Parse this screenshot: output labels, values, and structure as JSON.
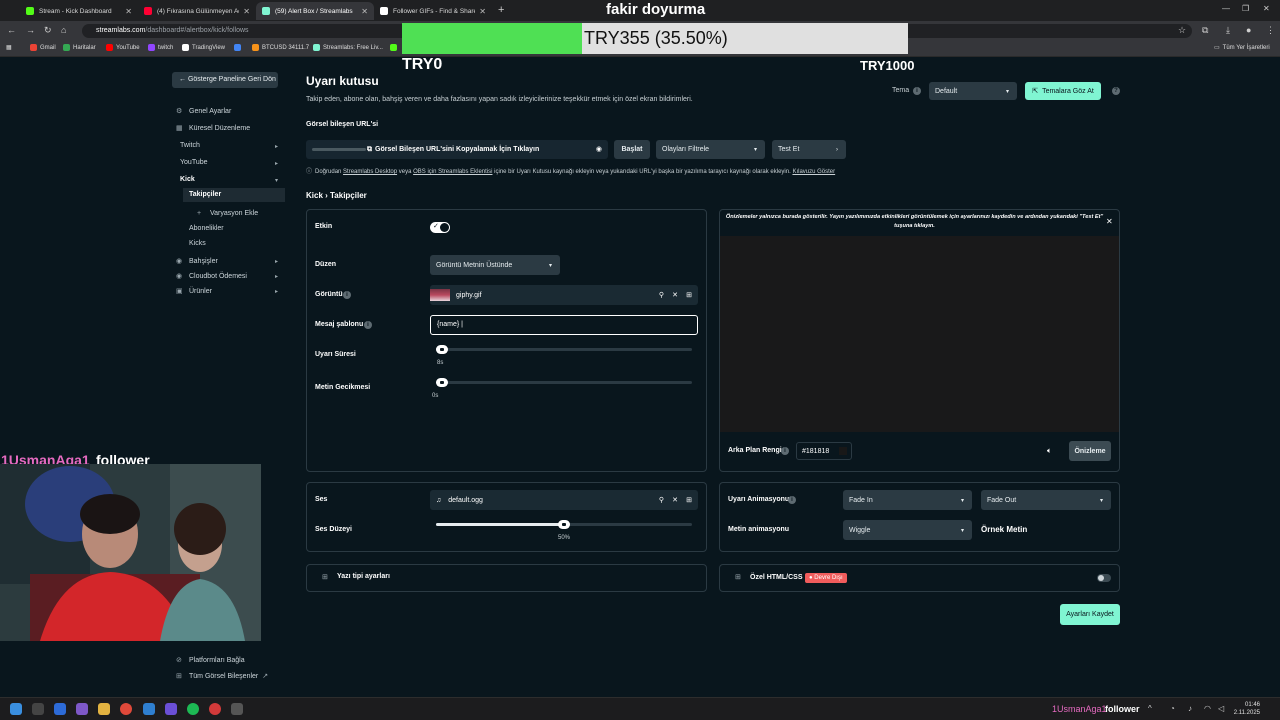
{
  "browser": {
    "tabs": [
      {
        "title": "Stream - Kick Dashboard",
        "color": "#53fc18"
      },
      {
        "title": "(4) Fıkrasına Gülünmeyen Adam",
        "color": "#ff0033"
      },
      {
        "title": "(59) Alert Box / Streamlabs",
        "color": "#80f5d2"
      },
      {
        "title": "Follower GIFs - Find & Share on",
        "color": "#ffffff"
      }
    ],
    "url_host": "streamlabs.com",
    "url_path": "/dashboard#/alertbox/kick/follows",
    "bookmarks": [
      {
        "label": "Gmail",
        "color": "#ea4335"
      },
      {
        "label": "Haritalar",
        "color": "#34a853"
      },
      {
        "label": "YouTube",
        "color": "#ff0000"
      },
      {
        "label": "twitch",
        "color": "#9146ff"
      },
      {
        "label": "TradingView",
        "color": "#ffffff"
      },
      {
        "label": "",
        "color": "#4285f4"
      },
      {
        "label": "BTCUSD 34111.7",
        "color": "#f7931a"
      },
      {
        "label": "Streamlabs: Free Liv...",
        "color": "#80f5d2"
      },
      {
        "label": "",
        "color": "#53fc18"
      }
    ],
    "all_bookmarks": "Tüm Yer İşaretleri"
  },
  "overlay": {
    "title": "fakir doyurma",
    "goal_text": "TRY355 (35.50%)",
    "goal_progress": 0.355,
    "goal_min": "TRY0",
    "goal_max": "TRY1000",
    "follower_name": "1UsmanAga1",
    "follower_label": "follower"
  },
  "sidebar": {
    "back": "← Gösterge Paneline Geri Dön",
    "items": [
      {
        "label": "Genel Ayarlar",
        "icon": "gear-icon"
      },
      {
        "label": "Küresel Düzenleme",
        "icon": "layout-icon"
      },
      {
        "label": "Twitch"
      },
      {
        "label": "YouTube"
      },
      {
        "label": "Kick"
      },
      {
        "label": "Takipçiler"
      },
      {
        "label": "Varyasyon Ekle"
      },
      {
        "label": "Abonelikler"
      },
      {
        "label": "Kicks"
      },
      {
        "label": "Bahşişler",
        "icon": "coin-icon"
      },
      {
        "label": "Cloudbot Ödemesi",
        "icon": "bot-icon"
      },
      {
        "label": "Ürünler",
        "icon": "box-icon"
      }
    ],
    "footer": [
      "Platformları Bağla",
      "Tüm Görsel Bileşenler"
    ]
  },
  "main": {
    "title": "Uyarı kutusu",
    "description": "Takip eden, abone olan, bahşiş veren ve daha fazlasını yapan sadık izleyicilerinize teşekkür etmek için özel ekran bildirimleri.",
    "theme_label": "Tema",
    "theme_value": "Default",
    "browse_themes": "Temalara Göz At",
    "widget_url_label": "Görsel bileşen URL'si",
    "copy_url": "Görsel Bileşen URL'sini Kopyalamak İçin Tıklayın",
    "start": "Başlat",
    "filter": "Olayları Filtrele",
    "test": "Test Et",
    "info": {
      "a": "Doğrudan",
      "b": "Streamlabs Desktop",
      "c": "veya",
      "d": "OBS için Streamlabs Eklentisi",
      "e": "içine bir Uyarı Kutusu kaynağı ekleyin veya yukarıdaki URL'yi başka bir yazılıma tarayıcı kaynağı olarak ekleyin.",
      "f": "Kılavuzu Göster"
    },
    "breadcrumb": "Kick › Takipçiler",
    "enabled_label": "Etkin",
    "layout_label": "Düzen",
    "layout_value": "Görüntü Metnin Üstünde",
    "image_label": "Görüntü",
    "image_file": "giphy.gif",
    "template_label": "Mesaj şablonu",
    "template_value": "{name} |",
    "duration_label": "Uyarı Süresi",
    "duration_value": "8s",
    "duration_fraction": 0.02,
    "delay_label": "Metin Gecikmesi",
    "delay_value": "0s",
    "delay_fraction": 0.0,
    "sound_label": "Ses",
    "sound_file": "default.ogg",
    "volume_label": "Ses Düzeyi",
    "volume_value": "50%",
    "volume_fraction": 0.5,
    "font_settings": "Yazı tipi ayarları",
    "preview_note": "Önizlemeler yalnızca burada gösterilir. Yayın yazılımınızda etkinlikleri görüntülemek için ayarlarınızı kaydedin ve ardından yukarıdaki \"Test Et\" tuşuna tıklayın.",
    "bg_label": "Arka Plan Rengi",
    "bg_value": "#181818",
    "preview_btn": "Önizleme",
    "anim_label": "Uyarı Animasyonu",
    "anim_in": "Fade In",
    "anim_out": "Fade Out",
    "text_anim_label": "Metin animasyonu",
    "text_anim_value": "Wiggle",
    "sample_text": "Örnek Metin",
    "custom_css": "Özel HTML/CSS",
    "custom_css_status": "● Devre Dışı",
    "save": "Ayarları Kaydet"
  },
  "taskbar": {
    "time": "01:46",
    "date": "2.11.2025"
  }
}
